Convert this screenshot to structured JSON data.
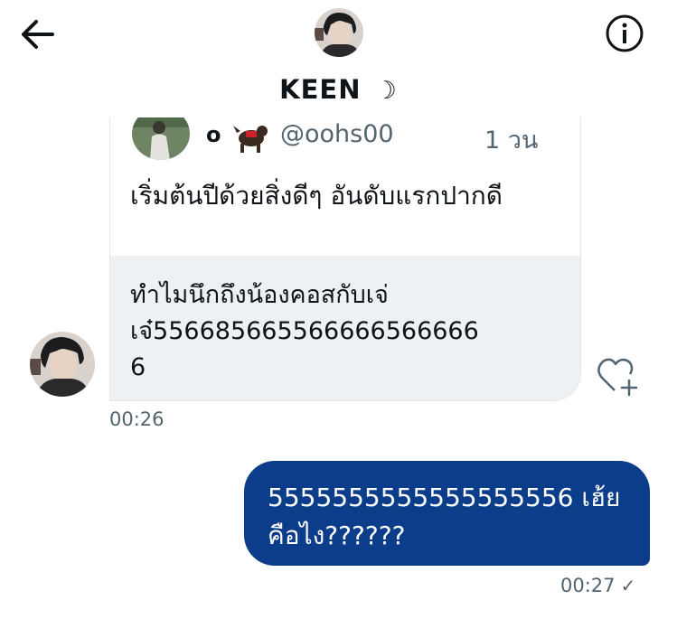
{
  "header": {
    "name": "KEEN",
    "name_symbol": "☽",
    "back_icon": "arrow-left-icon",
    "info_icon": "info-circle-icon"
  },
  "quoted_tweet": {
    "author_name": "o",
    "author_handle": "@oohs00",
    "time": "1 วน",
    "text": "เริ่มต้นปีด้วยสิ่งดีๆ อันดับแรกปากดี",
    "reply_text": "ทำไมนึกถึงน้องคอสกับเจ่\nเจ๋556685665566666566666\n6"
  },
  "incoming": {
    "time": "00:26",
    "react_icon": "heart-plus-icon"
  },
  "outgoing": {
    "text": "5555555555555555556 เฮ้ย\nคือไง??????",
    "time": "00:27",
    "status_icon": "✓"
  },
  "colors": {
    "outgoing_bubble": "#0c3d8a",
    "incoming_bg": "#eef1f4",
    "muted_text": "#536471"
  }
}
